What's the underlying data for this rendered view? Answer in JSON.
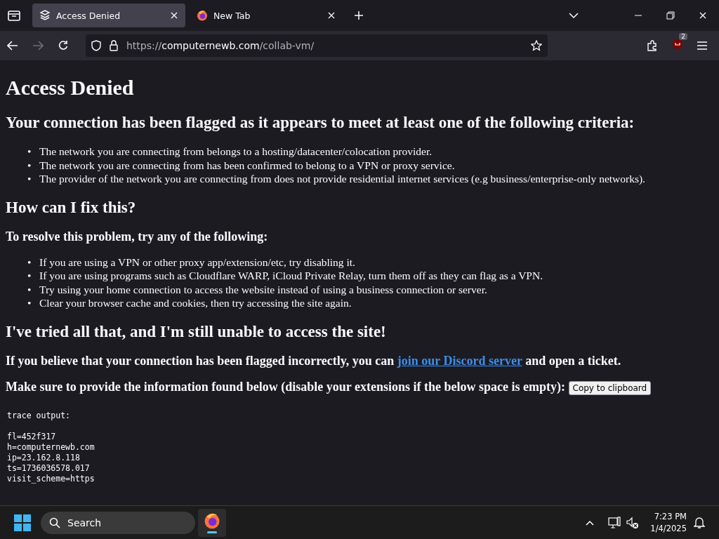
{
  "browser": {
    "tabs": [
      {
        "title": "Access Denied",
        "selected": true,
        "kind": "site"
      },
      {
        "title": "New Tab",
        "selected": false,
        "kind": "firefox"
      }
    ],
    "url": {
      "scheme": "https://",
      "host": "computernewb.com",
      "path": "/collab-vm/"
    },
    "extensions_badge": "2"
  },
  "page": {
    "title": "Access Denied",
    "criteria_heading": "Your connection has been flagged as it appears to meet at least one of the following criteria:",
    "list_marker": "•",
    "criteria": [
      "The network you are connecting from belongs to a hosting/datacenter/colocation provider.",
      "The network you are connecting from has been confirmed to belong to a VPN or proxy service.",
      "The provider of the network you are connecting from does not provide residential internet services (e.g business/enterprise-only networks)."
    ],
    "fix_heading": "How can I fix this?",
    "fix_intro": "To resolve this problem, try any of the following:",
    "fixes": [
      "If you are using a VPN or other proxy app/extension/etc, try disabling it.",
      "If you are using programs such as Cloudflare WARP, iCloud Private Relay, turn them off as they can flag as a VPN.",
      "Try using your home connection to access the website instead of using a business connection or server.",
      "Clear your browser cache and cookies, then try accessing the site again."
    ],
    "tried_heading": "I've tried all that, and I'm still unable to access the site!",
    "flagged_text": {
      "before": "If you believe that your connection has been flagged incorrectly, you can",
      "link": "join our Discord server",
      "after": "and open a ticket."
    },
    "info_text": "Make sure to provide the information found below (disable your extensions if the below space is empty):",
    "copy_button": "Copy to clipboard",
    "trace_label": "trace output:",
    "trace_lines": [
      "fl=452f317",
      "h=computernewb.com",
      "ip=23.162.8.118",
      "ts=1736036578.017",
      "visit_scheme=https"
    ]
  },
  "taskbar": {
    "search": {
      "placeholder": "Search"
    },
    "time": "7:23 PM",
    "date": "1/4/2025"
  }
}
